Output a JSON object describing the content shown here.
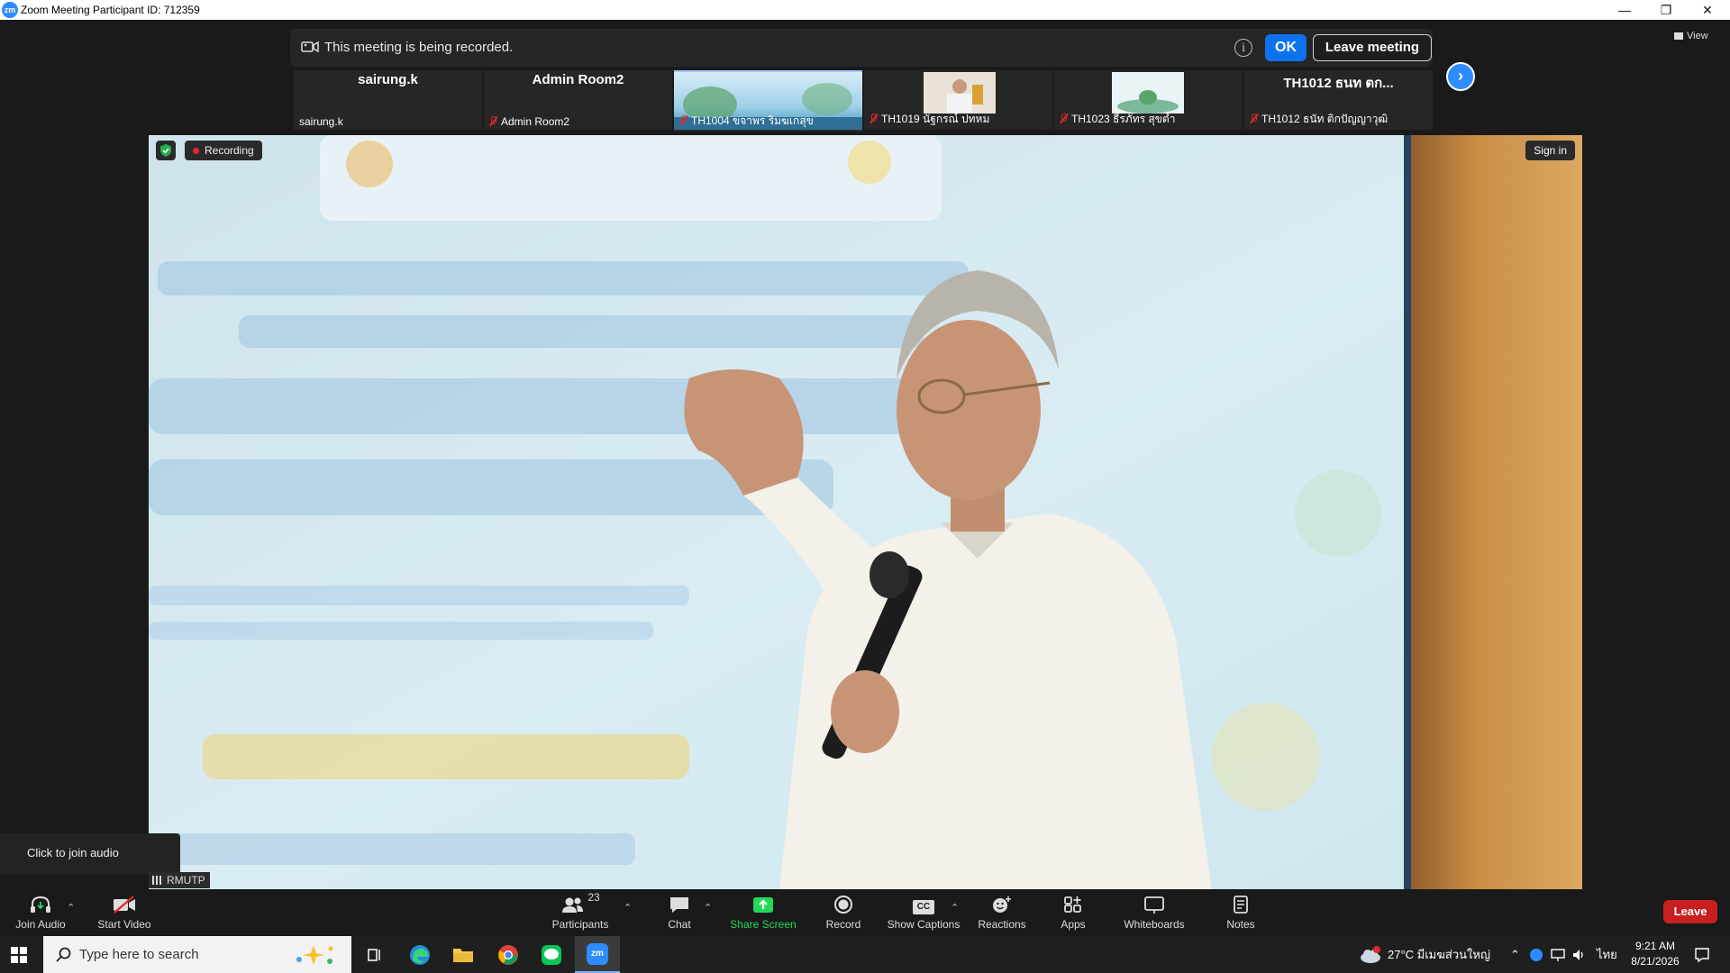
{
  "window": {
    "title": "Zoom Meeting Participant ID: 712359",
    "app_logo": "zm"
  },
  "banner": {
    "message": "This meeting is being recorded.",
    "ok_label": "OK",
    "leave_label": "Leave meeting"
  },
  "view": {
    "label": "View"
  },
  "participants": [
    {
      "big_name": "sairung.k",
      "label": "sairung.k",
      "muted": false
    },
    {
      "big_name": "Admin Room2",
      "label": "Admin Room2",
      "muted": true
    },
    {
      "big_name": "",
      "label": "TH1004 ขจาพร ริมฆเกสุข",
      "muted": true
    },
    {
      "big_name": "",
      "label": "TH1019 นัฐกรณ์ ปทหม",
      "muted": true
    },
    {
      "big_name": "",
      "label": "TH1023 ธีรภัทร สุขต่ำ",
      "muted": true
    },
    {
      "big_name": "TH1012 ธนท ตก...",
      "label": "TH1012 ธนัท ติกปัญญาวุฒิ",
      "muted": true
    }
  ],
  "video": {
    "recording_label": "Recording",
    "signin_label": "Sign in"
  },
  "tooltip": {
    "text": "Click to join audio"
  },
  "network": {
    "label": "RMUTP"
  },
  "toolbar": {
    "join_audio": "Join Audio",
    "start_video": "Start Video",
    "participants": "Participants",
    "participant_count": "23",
    "chat": "Chat",
    "share_screen": "Share Screen",
    "record": "Record",
    "show_captions": "Show Captions",
    "captions_icon": "CC",
    "reactions": "Reactions",
    "apps": "Apps",
    "whiteboards": "Whiteboards",
    "notes": "Notes",
    "leave": "Leave",
    "share_color": "#23d959",
    "leave_color": "#c8201f"
  },
  "taskbar": {
    "search_placeholder": "Type here to search",
    "weather": "27°C  มีเมฆส่วนใหญ่",
    "language": "ไทย",
    "time": "9:21 AM",
    "date": "8/21/2026",
    "zoom_icon": "zm"
  }
}
